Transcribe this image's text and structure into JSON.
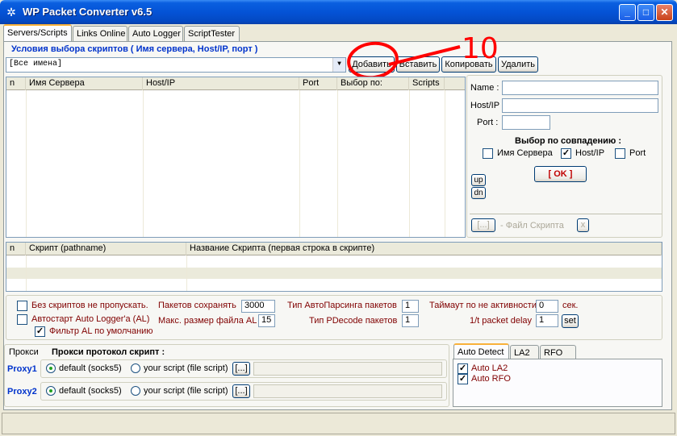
{
  "window": {
    "title": "WP Packet Converter v6.5",
    "buttons": {
      "minimize": "_",
      "maximize": "□",
      "close": "✕"
    }
  },
  "tabs": [
    "Servers/Scripts",
    "Links Online",
    "Auto Logger",
    "ScriptTester"
  ],
  "scripts_section": {
    "heading": "Условия выбора скриптов ( Имя сервера, Host/IP, порт )",
    "filter_combo_value": "[Все имена]",
    "buttons": {
      "add": "Добавить",
      "insert": "Вставить",
      "copy": "Копировать",
      "delete": "Удалить"
    }
  },
  "servers_table": {
    "columns": [
      "n",
      "Имя Сервера",
      "Host/IP",
      "Port",
      "Выбор по:",
      "Scripts"
    ]
  },
  "server_form": {
    "name_label": "Name :",
    "host_label": "Host/IP",
    "port_label": "Port :",
    "match_heading": "Выбор по совпадению :",
    "match_server_label": "Имя Сервера",
    "match_host_label": "Host/IP",
    "match_port_label": "Port",
    "ok_label": "[ OK ]",
    "up_label": "up",
    "dn_label": "dn",
    "browse_label": "[...]",
    "script_file_label": "- Файл Скрипта",
    "clear_label": "x"
  },
  "scripts_table": {
    "columns": [
      "n",
      "Скрипт (pathname)",
      "Название Скрипта (первая строка в скрипте)"
    ]
  },
  "options": {
    "no_scripts_skip": "Без скриптов не пропускать.",
    "autostart_logger": "Автостарт Auto Logger'a (AL)",
    "filter_al_default": "Фильтр AL по умолчанию",
    "packets_keep_label": "Пакетов сохранять",
    "packets_keep_value": "3000",
    "max_file_size_label": "Макс. размер файла AL",
    "max_file_size_value": "15",
    "autoparse_type_label": "Тип АвтоПарсинга пакетов",
    "autoparse_type_value": "1",
    "pdecode_type_label": "Тип PDecode пакетов",
    "pdecode_type_value": "1",
    "inactivity_timeout_label": "Таймаут по не активности",
    "inactivity_timeout_value": "0",
    "inactivity_unit": "сек.",
    "packet_delay_label": "1/t packet delay",
    "packet_delay_value": "1",
    "set_label": "set"
  },
  "proxy": {
    "tab_label": "Прокси",
    "heading": "Прокси протокол скрипт :",
    "proxy1_label": "Proxy1",
    "proxy2_label": "Proxy2",
    "default_label": "default (socks5)",
    "script_label": "your script (file script)",
    "browse_label": "[...]"
  },
  "auto_detect": {
    "tabs": [
      "Auto Detect",
      "LA2",
      "RFO"
    ],
    "auto_la2": "Auto LA2",
    "auto_rfo": "Auto RFO"
  },
  "annotation": {
    "text": "10",
    "color": "#ff0000"
  }
}
